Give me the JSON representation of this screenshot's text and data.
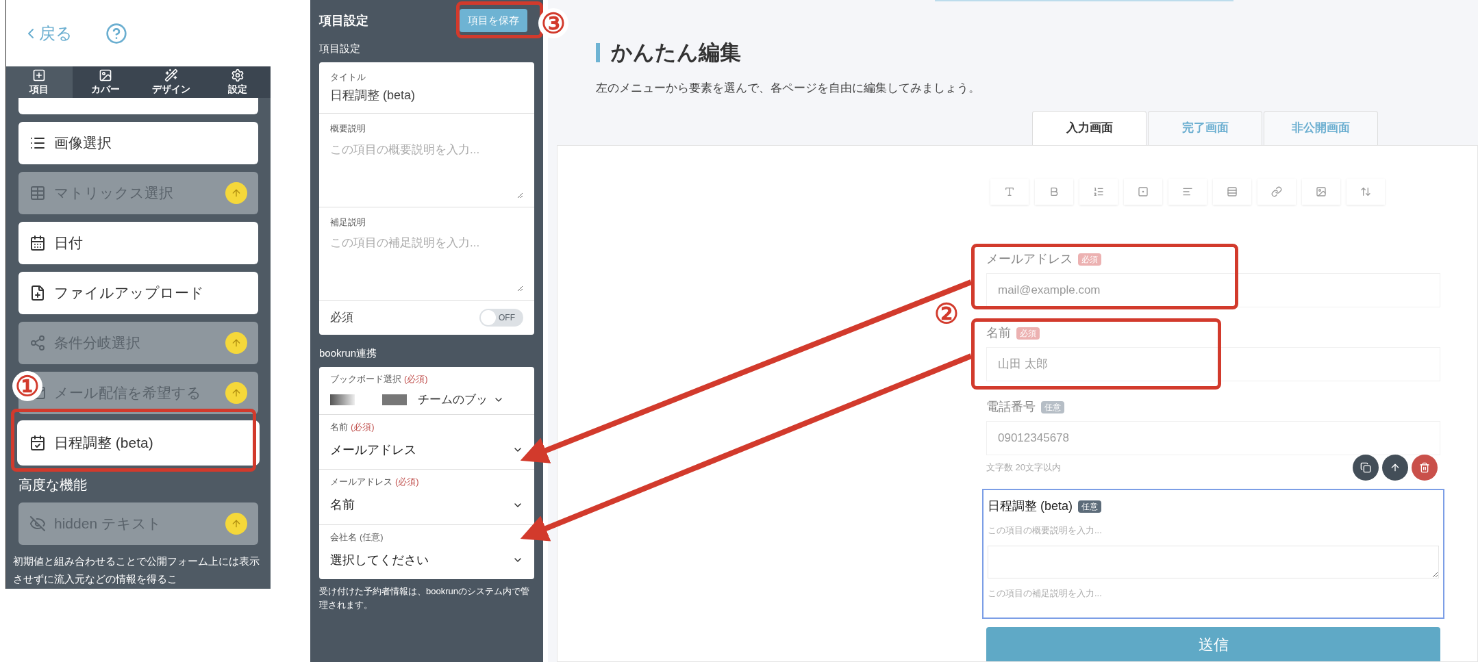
{
  "left_panel": {
    "back_link": "戻る",
    "tabs": [
      {
        "label": "項目",
        "selected": true
      },
      {
        "label": "カバー",
        "selected": false
      },
      {
        "label": "デザイン",
        "selected": false
      },
      {
        "label": "設定",
        "selected": false
      }
    ],
    "items": [
      {
        "label": "画像選択",
        "kind": "image_select",
        "locked": false,
        "selected": false
      },
      {
        "label": "マトリックス選択",
        "kind": "matrix",
        "locked": true,
        "selected": false
      },
      {
        "label": "日付",
        "kind": "date",
        "locked": false,
        "selected": false
      },
      {
        "label": "ファイルアップロード",
        "kind": "file",
        "locked": false,
        "selected": false
      },
      {
        "label": "条件分岐選択",
        "kind": "branch",
        "locked": true,
        "selected": false
      },
      {
        "label": "メール配信を希望する",
        "kind": "mail",
        "locked": true,
        "selected": false
      },
      {
        "label": "日程調整 (beta)",
        "kind": "schedule",
        "locked": false,
        "selected": true
      }
    ],
    "advanced_section": "高度な機能",
    "advanced_items": [
      {
        "label": "hidden テキスト",
        "kind": "hidden",
        "locked": true,
        "selected": false
      }
    ],
    "description": "初期値と組み合わせることで公開フォーム上には表示させずに流入元などの情報を得るこ"
  },
  "settings_panel": {
    "title": "項目設定",
    "save_button": "項目を保存",
    "section": "項目設定",
    "title_field": {
      "label": "タイトル",
      "value": "日程調整 (beta)"
    },
    "text_areas": [
      {
        "label": "概要説明",
        "placeholder": "この項目の概要説明を入力..."
      },
      {
        "label": "補足説明",
        "placeholder": "この項目の補足説明を入力..."
      }
    ],
    "required_toggle": {
      "label": "必須",
      "on": false,
      "state_text": "OFF"
    },
    "bookrun_section": "bookrun連携",
    "board": {
      "label": "ブックボード選択",
      "tag": "(必須)",
      "required": true,
      "value": "チームのブッ"
    },
    "mappings": [
      {
        "label": "名前",
        "tag": "(必須)",
        "required": true,
        "value": "メールアドレス"
      },
      {
        "label": "メールアドレス",
        "tag": "(必須)",
        "required": true,
        "value": "名前"
      },
      {
        "label": "会社名",
        "tag": "(任意)",
        "required": false,
        "value": "選択してください"
      }
    ],
    "note": "受け付けた予約者情報は、bookrunのシステム内で管理されます。"
  },
  "editor": {
    "heading": "かんたん編集",
    "subtitle": "左のメニューから要素を選んで、各ページを自由に編集してみましょう。",
    "tabs": [
      {
        "label": "入力画面",
        "selected": true
      },
      {
        "label": "完了画面",
        "selected": false
      },
      {
        "label": "非公開画面",
        "selected": false
      }
    ],
    "fields": [
      {
        "label": "メールアドレス",
        "badge": "必須",
        "required": true,
        "placeholder": "mail@example.com"
      },
      {
        "label": "名前",
        "badge": "必須",
        "required": true,
        "placeholder": "山田 太郎"
      },
      {
        "label": "電話番号",
        "badge": "任意",
        "required": false,
        "placeholder": "09012345678",
        "hint": "文字数 20文字以内"
      }
    ],
    "selected_item": {
      "title": "日程調整 (beta)",
      "badge": "任意",
      "summary_placeholder": "この項目の概要説明を入力...",
      "note_placeholder": "この項目の補足説明を入力..."
    },
    "submit_button": "送信"
  },
  "annotations": [
    {
      "label": "①"
    },
    {
      "label": "②"
    },
    {
      "label": "③"
    }
  ]
}
